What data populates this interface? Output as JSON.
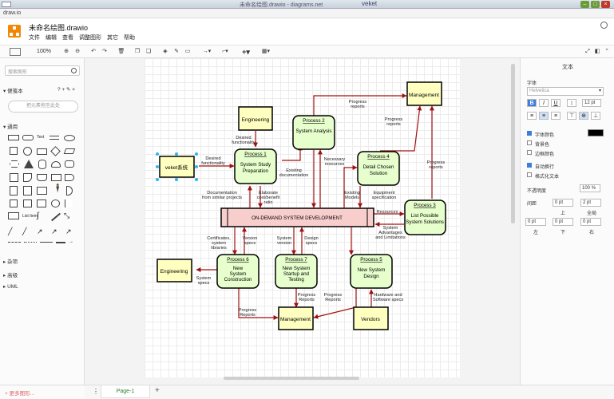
{
  "os": {
    "window_title": "未命名绘图.drawio - diagrams.net",
    "brand": "veket",
    "min": "–",
    "max": "□",
    "close": "×"
  },
  "app": {
    "name": "draw.io",
    "doc_title": "未命名绘图.drawio",
    "menu": [
      "文件",
      "编辑",
      "查看",
      "调整图形",
      "其它",
      "帮助"
    ]
  },
  "toolbar": {
    "zoom": "100%"
  },
  "sidebar": {
    "search_placeholder": "搜索图形",
    "scratchpad_title": "便笺本",
    "scratchpad_actions": "? + ✎ ×",
    "drop_hint": "把元素拖至此处",
    "general_title": "通用",
    "sections": [
      "杂项",
      "高级",
      "UML"
    ],
    "more_shapes": "+ 更多图形..."
  },
  "diagram": {
    "boxes": {
      "veket": "veket系统",
      "eng_top": "Engineering",
      "mgmt_top": "Management",
      "p1_title": "Process 1",
      "p1_body": [
        "System Study",
        "Preparation"
      ],
      "p2_title": "Process 2",
      "p2_body": [
        "System Analysis"
      ],
      "p3_title": "Process 3",
      "p3_body": [
        "List Possible",
        "System Solutions"
      ],
      "p4_title": "Process 4",
      "p4_body": [
        "Detail Chosen",
        "Solution"
      ],
      "central": "ON-DEMAND SYSTEM DEVELOPMENT",
      "p6_title": "Process 6",
      "p6_body": [
        "New",
        "System",
        "Construction"
      ],
      "p7_title": "Process 7",
      "p7_body": [
        "New System",
        "Startup and",
        "Testing"
      ],
      "p5_title": "Process 5",
      "p5_body": [
        "New System",
        "Design"
      ],
      "eng_left": "Engineering",
      "mgmt_bottom": "Management",
      "vendors": "Vendors"
    },
    "labels": {
      "progress_reports_top": [
        "Progress",
        "reports"
      ],
      "desired_func_1": [
        "Desired",
        "functionality"
      ],
      "desired_func_2": [
        "Desired",
        "functionality"
      ],
      "progress_reports_right": [
        "Progress",
        "reports"
      ],
      "necessary_resources": [
        "Necessary",
        "resources"
      ],
      "existing_documentation": [
        "Existing",
        "documentation"
      ],
      "progress_reports_p3": [
        "Progress",
        "reports"
      ],
      "documentation": [
        "Documentation",
        "from similar projects"
      ],
      "elaborate": [
        "Elaborate",
        "cost/benefit",
        "ratio"
      ],
      "existing_models": [
        "Existing",
        "Models"
      ],
      "equipment": [
        "Equipment",
        "specification"
      ],
      "resources": [
        "Resources"
      ],
      "advantages": [
        "System",
        "Advantages",
        "and Limitations"
      ],
      "certificates": [
        "Certificates,",
        "system",
        "libraries"
      ],
      "version_specs": [
        "Version",
        "specs"
      ],
      "system_version": [
        "System",
        "version"
      ],
      "design_specs": [
        "Design",
        "specs"
      ],
      "system_specs": [
        "System",
        "specs"
      ],
      "progress_p6": [
        "Progress",
        "Reports"
      ],
      "progress_p7": [
        "Progress",
        "Reports"
      ],
      "progress_p5": [
        "Progress",
        "Reports"
      ],
      "hardware": [
        "Hardware and",
        "Software specs"
      ]
    }
  },
  "format_panel": {
    "tab": "文本",
    "font_label": "字体",
    "font": "Helvetica",
    "font_size": "12 pt",
    "font_color_label": "字体颜色",
    "bg_color_label": "背景色",
    "border_color_label": "边框颜色",
    "wrap_label": "自动换行",
    "formatted_label": "格式化文本",
    "opacity_label": "不透明度",
    "opacity": "100 %",
    "spacing_label": "间距",
    "top_val": "0 pt",
    "top_label": "上",
    "global_val": "2 pt",
    "global_label": "全局",
    "left_val": "0 pt",
    "left_label": "左",
    "bottom_val": "0 pt",
    "bottom_label": "下",
    "right_val": "0 pt",
    "right_label": "右"
  },
  "bottom": {
    "page_tab": "Page-1",
    "add": "+",
    "menu": "⋮"
  },
  "colors": {
    "process_fill": "#e6ffcc",
    "entity_fill": "#ffffc0",
    "central_fill": "#f8cecc",
    "arrow": "#a01010",
    "accent": "#f08705"
  }
}
